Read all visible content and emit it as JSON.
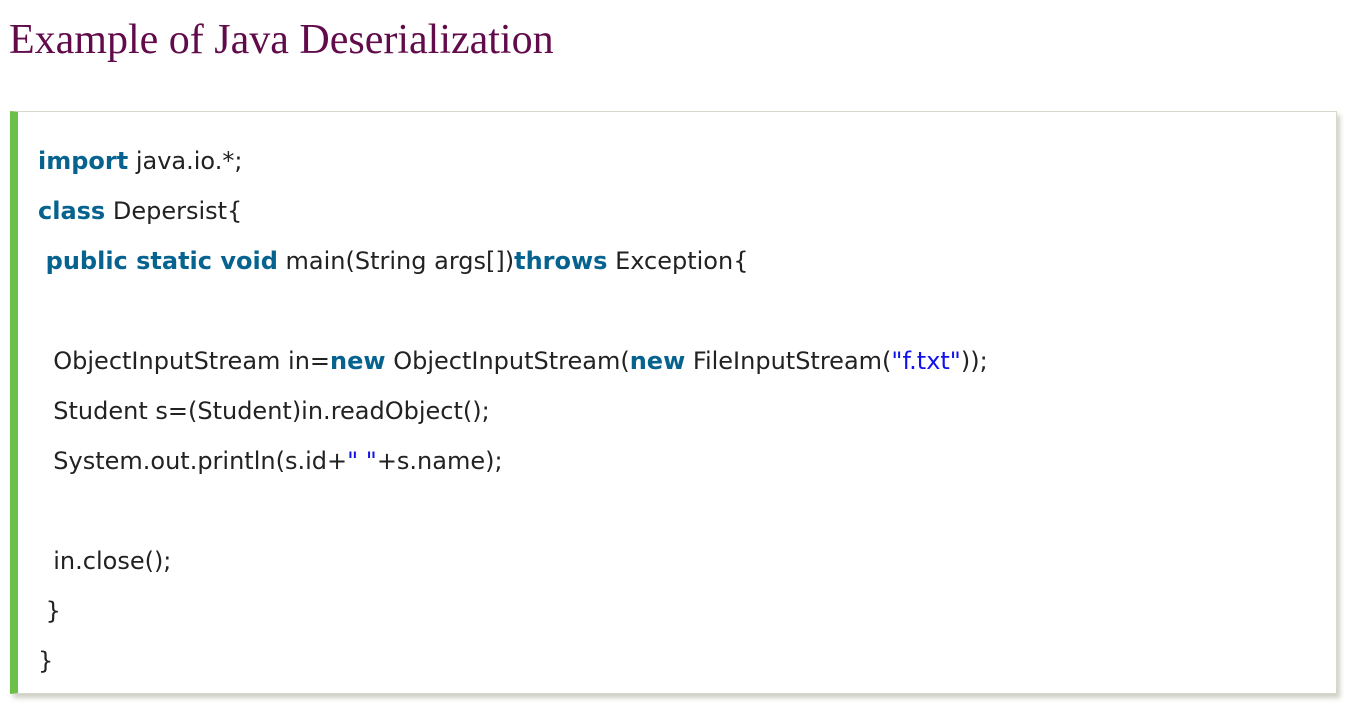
{
  "page": {
    "title": "Example of Java Deserialization"
  },
  "colors": {
    "title": "#610b4b",
    "keyword": "#06638f",
    "string": "#1111ee",
    "accent_border": "#6cc04a",
    "text": "#222222"
  },
  "code": {
    "l1": {
      "kw": "import",
      "rest": " java.io.*;"
    },
    "l2": {
      "kw": "class",
      "rest": " Depersist{"
    },
    "l3": {
      "indent": " ",
      "kw1": "public static void",
      "mid": " main(String args[])",
      "kw2": "throws",
      "rest": " Exception{"
    },
    "l5": {
      "indent": "  ",
      "t1": "ObjectInputStream in=",
      "kw1": "new",
      "t2": " ObjectInputStream(",
      "kw2": "new",
      "t3": " FileInputStream(",
      "str": "\"f.txt\"",
      "t4": "));"
    },
    "l6": {
      "text": "  Student s=(Student)in.readObject();"
    },
    "l7": {
      "t1": "  System.out.println(s.id+",
      "str": "\" \"",
      "t2": "+s.name);"
    },
    "l9": {
      "text": "  in.close();"
    },
    "l10": {
      "text": " }"
    },
    "l11": {
      "text": "}"
    }
  }
}
